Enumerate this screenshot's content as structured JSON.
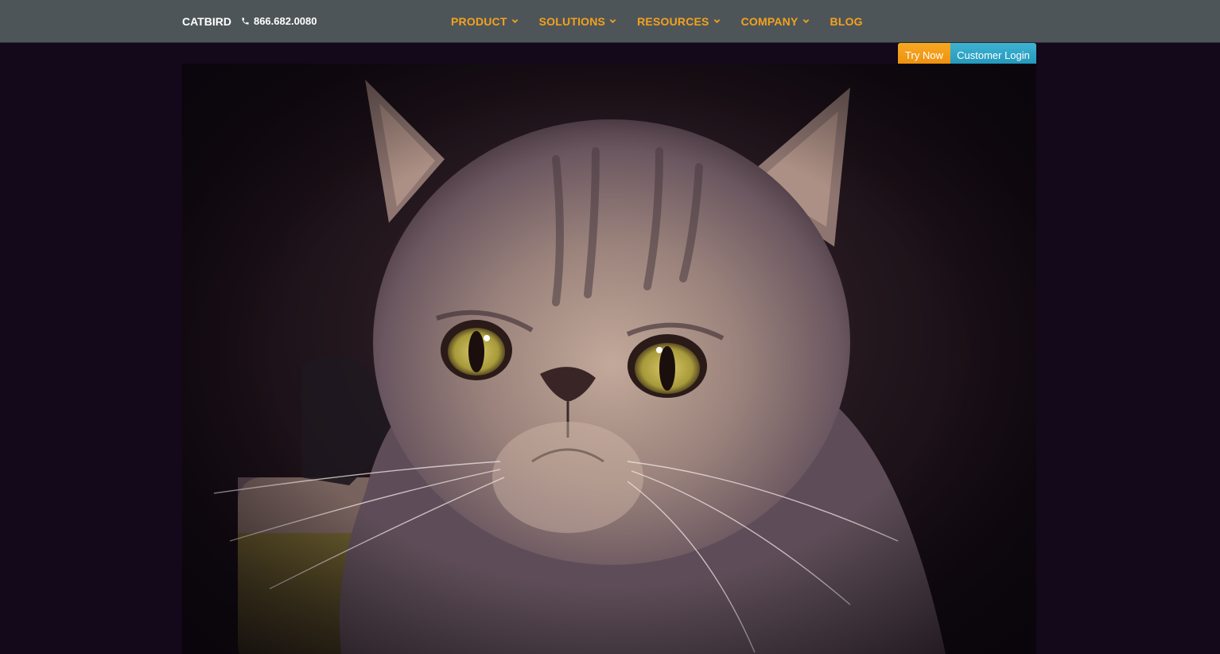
{
  "header": {
    "brand": "CATBIRD",
    "phone": "866.682.0080"
  },
  "nav": {
    "items": [
      {
        "label": "PRODUCT",
        "has_dropdown": true
      },
      {
        "label": "SOLUTIONS",
        "has_dropdown": true
      },
      {
        "label": "RESOURCES",
        "has_dropdown": true
      },
      {
        "label": "COMPANY",
        "has_dropdown": true
      },
      {
        "label": "BLOG",
        "has_dropdown": false
      }
    ]
  },
  "cta": {
    "try_label": "Try Now",
    "login_label": "Customer Login"
  },
  "colors": {
    "navbar_bg": "#4e5558",
    "nav_link": "#f3a21e",
    "try_button": "#f39a18",
    "login_button": "#2ba3c6",
    "page_bg": "#14091a"
  },
  "icons": {
    "phone": "phone-icon",
    "dropdown": "chevron-down-icon"
  }
}
